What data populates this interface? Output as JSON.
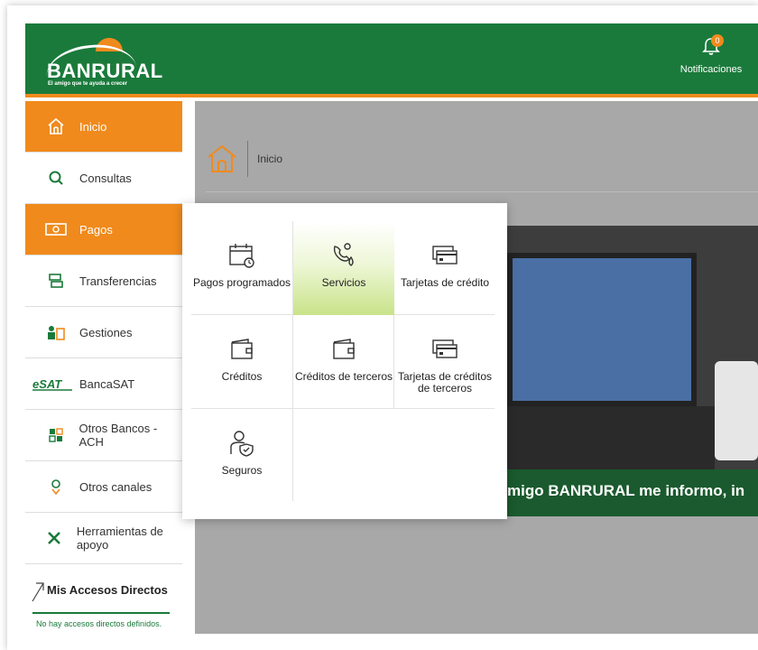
{
  "header": {
    "brand": "BANRURAL",
    "tagline": "El amigo que te ayuda a crecer",
    "notifications_label": "Notificaciones",
    "notifications_count": "0"
  },
  "sidebar": {
    "items": [
      {
        "label": "Inicio",
        "icon": "home-icon"
      },
      {
        "label": "Consultas",
        "icon": "search-icon"
      },
      {
        "label": "Pagos",
        "icon": "cash-icon"
      },
      {
        "label": "Transferencias",
        "icon": "transfer-icon"
      },
      {
        "label": "Gestiones",
        "icon": "gestiones-icon"
      },
      {
        "label": "BancaSAT",
        "icon": "sat-logo-icon"
      },
      {
        "label": "Otros Bancos - ACH",
        "icon": "bank-icon"
      },
      {
        "label": "Otros canales",
        "icon": "channels-icon"
      },
      {
        "label": "Herramientas de apoyo",
        "icon": "tools-icon"
      }
    ]
  },
  "accesos": {
    "title": "Mis Accesos Directos",
    "empty": "No hay accesos directos definidos."
  },
  "breadcrumb": {
    "current": "Inicio"
  },
  "banner": {
    "text": "migo BANRURAL me informo, in"
  },
  "pagos_menu": {
    "items": [
      {
        "label": "Pagos programados",
        "icon": "calendar-icon"
      },
      {
        "label": "Servicios",
        "icon": "services-icon"
      },
      {
        "label": "Tarjetas de crédito",
        "icon": "credit-card-icon"
      },
      {
        "label": "Créditos",
        "icon": "wallet-icon"
      },
      {
        "label": "Créditos de terceros",
        "icon": "wallet-icon"
      },
      {
        "label": "Tarjetas de créditos de terceros",
        "icon": "credit-card-icon"
      },
      {
        "label": "Seguros",
        "icon": "insurance-icon"
      }
    ]
  },
  "colors": {
    "brand_green": "#1a7a3b",
    "accent_orange": "#f08a1c",
    "hover_green": "#c9e38a"
  }
}
